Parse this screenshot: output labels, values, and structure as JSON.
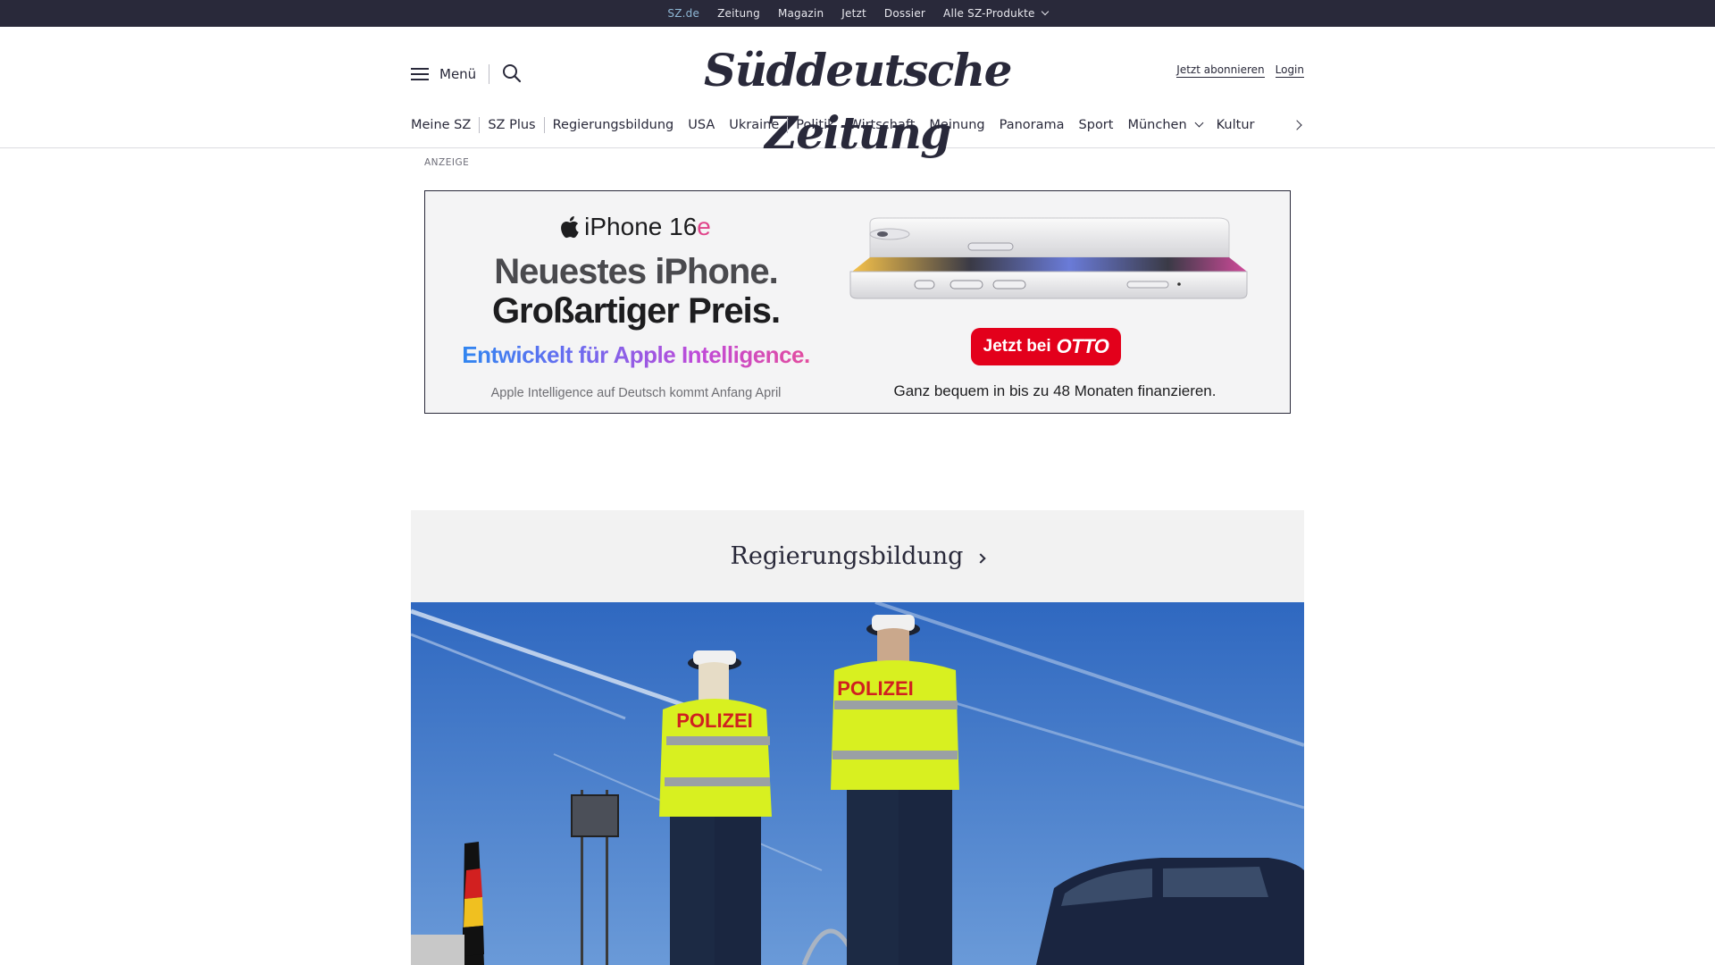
{
  "topbar": {
    "items": [
      "SZ.de",
      "Zeitung",
      "Magazin",
      "Jetzt",
      "Dossier",
      "Alle SZ-Produkte"
    ],
    "active": "SZ.de"
  },
  "header": {
    "menu_label": "Menü",
    "logo_text": "Süddeutsche Zeitung",
    "subscribe_label": "Jetzt abonnieren",
    "login_label": "Login"
  },
  "nav": {
    "items": [
      "Meine SZ",
      "SZ Plus",
      "Regierungsbildung",
      "USA",
      "Ukraine",
      "Politik",
      "Wirtschaft",
      "Meinung",
      "Panorama",
      "Sport",
      "München",
      "Kultur"
    ]
  },
  "ad": {
    "label": "ANZEIGE",
    "brand": "iPhone 16",
    "brand_suffix": "e",
    "headline_line1": "Neuestes iPhone.",
    "headline_line2": "Großartiger Preis.",
    "intelligence": "Entwickelt für Apple Intelligence.",
    "note": "Apple Intelligence auf Deutsch kommt Anfang April",
    "cta_prefix": "Jetzt bei",
    "cta_brand": "OTTO",
    "finance": "Ganz bequem in bis zu 48 Monaten finanzieren."
  },
  "topic": {
    "title": "Regierungsbildung"
  },
  "colors": {
    "topbar_bg": "#29293a",
    "active_link": "#8fb8d6",
    "otto_red": "#e3001b",
    "sky": "#3f78c8"
  }
}
